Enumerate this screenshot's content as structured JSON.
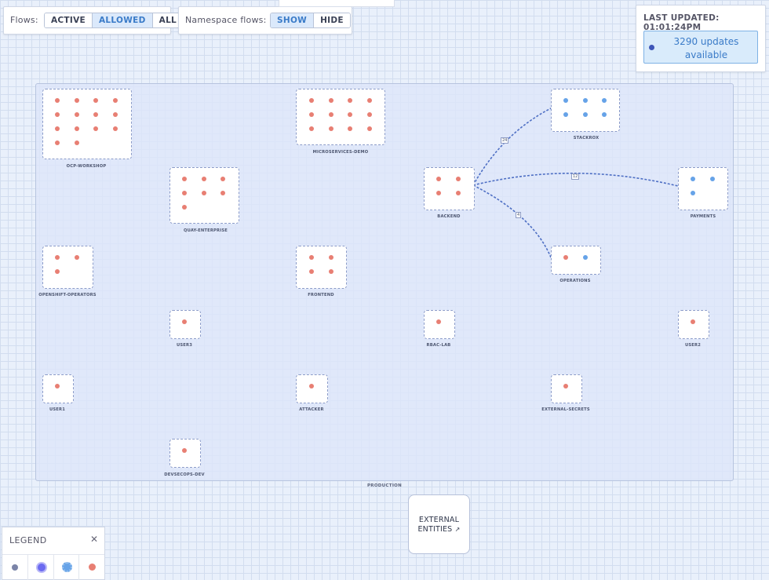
{
  "toolbar": {
    "flows_label": "Flows:",
    "flows_buttons": [
      "ACTIVE",
      "ALLOWED",
      "ALL"
    ],
    "flows_selected": "ALLOWED",
    "namespace_label": "Namespace flows:",
    "namespace_buttons": [
      "SHOW",
      "HIDE"
    ],
    "namespace_selected": "SHOW"
  },
  "updates": {
    "last_updated": "LAST UPDATED: 01:01:24PM",
    "available_line1": "3290 updates",
    "available_line2": "available"
  },
  "cluster": {
    "name": "PRODUCTION"
  },
  "namespaces": [
    {
      "name": "OCP-WORKSHOP",
      "deployments": 14,
      "color": "red"
    },
    {
      "name": "MICROSERVICES-DEMO",
      "deployments": 12,
      "color": "red"
    },
    {
      "name": "STACKROX",
      "deployments": 6,
      "color": "blue"
    },
    {
      "name": "QUAY-ENTERPRISE",
      "deployments": 7,
      "color": "red"
    },
    {
      "name": "BACKEND",
      "deployments": 4,
      "color": "red"
    },
    {
      "name": "PAYMENTS",
      "deployments": 3,
      "color": "blue"
    },
    {
      "name": "OPENSHIFT-OPERATORS",
      "deployments": 3,
      "color": "red"
    },
    {
      "name": "FRONTEND",
      "deployments": 4,
      "color": "red"
    },
    {
      "name": "OPERATIONS",
      "deployments": 2,
      "color": "mixed"
    },
    {
      "name": "USER3",
      "deployments": 1,
      "color": "red"
    },
    {
      "name": "RBAC-LAB",
      "deployments": 1,
      "color": "red"
    },
    {
      "name": "USER2",
      "deployments": 1,
      "color": "red"
    },
    {
      "name": "USER1",
      "deployments": 1,
      "color": "red"
    },
    {
      "name": "ATTACKER",
      "deployments": 1,
      "color": "red"
    },
    {
      "name": "EXTERNAL-SECRETS",
      "deployments": 1,
      "color": "red"
    },
    {
      "name": "DEVSECOPS-DEV",
      "deployments": 1,
      "color": "red"
    }
  ],
  "edges": [
    {
      "from": "BACKEND",
      "to": "STACKROX",
      "label": "24"
    },
    {
      "from": "BACKEND",
      "to": "PAYMENTS",
      "label": "12"
    },
    {
      "from": "BACKEND",
      "to": "OPERATIONS",
      "label": "4"
    }
  ],
  "external": {
    "line1": "EXTERNAL",
    "line2": "ENTITIES"
  },
  "legend": {
    "title": "LEGEND",
    "close_icon": "close-icon",
    "icons": [
      "deployment-icon",
      "active-deployment-icon",
      "allowed-deployment-icon",
      "non-isolated-deployment-icon"
    ]
  },
  "colors": {
    "non_isolated": "#e87f73",
    "isolated": "#66a3e8",
    "accent": "#3a7bc8",
    "edge": "#4e6fc4"
  }
}
